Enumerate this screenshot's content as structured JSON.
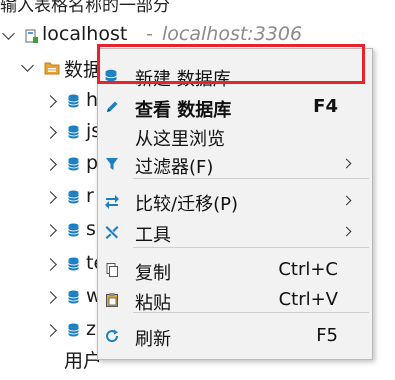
{
  "top_hint": "输入表格名称的一部分",
  "tree": {
    "connection": {
      "name": "localhost",
      "separator": "-",
      "host": "localhost:3306"
    },
    "folder_label": "数据",
    "db_items": [
      "h",
      "js",
      "p",
      "r",
      "s",
      "te",
      "w",
      "z"
    ],
    "bottom_partial": "用户"
  },
  "context_menu": {
    "items": [
      {
        "label": "新建 数据库",
        "shortcut": "",
        "icon": "database-add-icon",
        "bold": false,
        "submenu": false
      },
      {
        "label": "查看 数据库",
        "shortcut": "F4",
        "icon": "edit-pencil-icon",
        "bold": true,
        "submenu": false
      },
      {
        "label": "从这里浏览",
        "shortcut": "",
        "icon": "",
        "bold": false,
        "submenu": false
      },
      {
        "label": "过滤器(F)",
        "shortcut": "",
        "icon": "filter-icon",
        "bold": false,
        "submenu": true
      },
      {
        "label": "比较/迁移(P)",
        "shortcut": "",
        "icon": "compare-icon",
        "bold": false,
        "submenu": true
      },
      {
        "label": "工具",
        "shortcut": "",
        "icon": "tools-icon",
        "bold": false,
        "submenu": true
      },
      {
        "label": "复制",
        "shortcut": "Ctrl+C",
        "icon": "copy-icon",
        "bold": false,
        "submenu": false
      },
      {
        "label": "粘贴",
        "shortcut": "Ctrl+V",
        "icon": "paste-icon",
        "bold": false,
        "submenu": false
      },
      {
        "label": "刷新",
        "shortcut": "F5",
        "icon": "refresh-icon",
        "bold": false,
        "submenu": false
      }
    ]
  },
  "colors": {
    "highlight_border": "#e8232b",
    "db_icon": "#1b7fc2",
    "folder_icon": "#e8a23a",
    "menu_bg": "#f2f2f2"
  }
}
